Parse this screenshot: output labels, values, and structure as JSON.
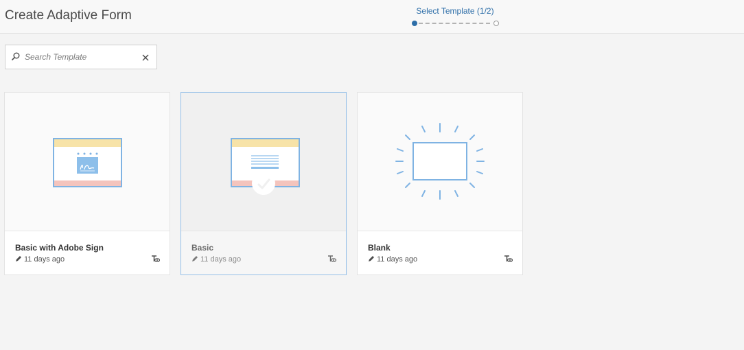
{
  "header": {
    "title": "Create Adaptive Form"
  },
  "wizard": {
    "label": "Select Template (1/2)"
  },
  "search": {
    "placeholder": "Search Template",
    "value": ""
  },
  "templates": [
    {
      "title": "Basic with Adobe Sign",
      "modified": "11 days ago",
      "selected": false,
      "thumbnail": "adobe-sign-form"
    },
    {
      "title": "Basic",
      "modified": "11 days ago",
      "selected": true,
      "thumbnail": "basic-form"
    },
    {
      "title": "Blank",
      "modified": "11 days ago",
      "selected": false,
      "thumbnail": "blank-form"
    }
  ],
  "colors": {
    "accent": "#2d6ea8",
    "selected_border": "#94bfe8",
    "thumb_stroke": "#7fb3e3"
  }
}
